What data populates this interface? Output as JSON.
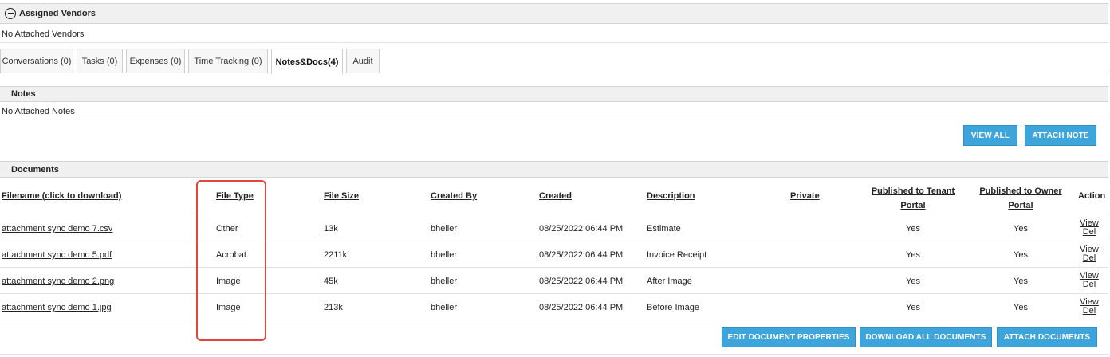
{
  "vendors": {
    "title": "Assigned Vendors",
    "empty_text": "No Attached Vendors"
  },
  "tabs": [
    {
      "label": "Conversations (0)",
      "active": false
    },
    {
      "label": "Tasks (0)",
      "active": false
    },
    {
      "label": "Expenses (0)",
      "active": false
    },
    {
      "label": "Time Tracking (0)",
      "active": false
    },
    {
      "label": "Notes&Docs(4)",
      "active": true
    },
    {
      "label": "Audit",
      "active": false
    }
  ],
  "notes": {
    "title": "Notes",
    "empty_text": "No Attached Notes",
    "view_all_label": "VIEW ALL",
    "attach_note_label": "ATTACH NOTE"
  },
  "documents": {
    "title": "Documents",
    "columns": {
      "filename": "Filename (click to download)",
      "file_type": "File Type",
      "file_size": "File Size",
      "created_by": "Created By",
      "created": "Created",
      "description": "Description",
      "private": "Private",
      "tenant_portal_line1": "Published to Tenant",
      "tenant_portal_line2": "Portal",
      "owner_portal_line1": "Published to Owner",
      "owner_portal_line2": "Portal",
      "action": "Action"
    },
    "rows": [
      {
        "filename": "attachment sync demo 7.csv",
        "file_type": "Other",
        "file_size": "13k",
        "created_by": "bheller",
        "created": "08/25/2022 06:44 PM",
        "description": "Estimate",
        "private": "",
        "tenant": "Yes",
        "owner": "Yes",
        "view": "View",
        "del": "Del"
      },
      {
        "filename": "attachment sync demo 5.pdf",
        "file_type": "Acrobat",
        "file_size": "2211k",
        "created_by": "bheller",
        "created": "08/25/2022 06:44 PM",
        "description": "Invoice Receipt",
        "private": "",
        "tenant": "Yes",
        "owner": "Yes",
        "view": "View",
        "del": "Del"
      },
      {
        "filename": "attachment sync demo 2.png",
        "file_type": "Image",
        "file_size": "45k",
        "created_by": "bheller",
        "created": "08/25/2022 06:44 PM",
        "description": "After Image",
        "private": "",
        "tenant": "Yes",
        "owner": "Yes",
        "view": "View",
        "del": "Del"
      },
      {
        "filename": "attachment sync demo 1.jpg",
        "file_type": "Image",
        "file_size": "213k",
        "created_by": "bheller",
        "created": "08/25/2022 06:44 PM",
        "description": "Before Image",
        "private": "",
        "tenant": "Yes",
        "owner": "Yes",
        "view": "View",
        "del": "Del"
      }
    ],
    "edit_properties_label": "EDIT DOCUMENT PROPERTIES",
    "download_all_label": "DOWNLOAD ALL DOCUMENTS",
    "attach_documents_label": "ATTACH DOCUMENTS"
  },
  "colors": {
    "button_blue": "#3ea4dc",
    "highlight_red": "#e0463a",
    "header_gray": "#f0f0f0"
  }
}
